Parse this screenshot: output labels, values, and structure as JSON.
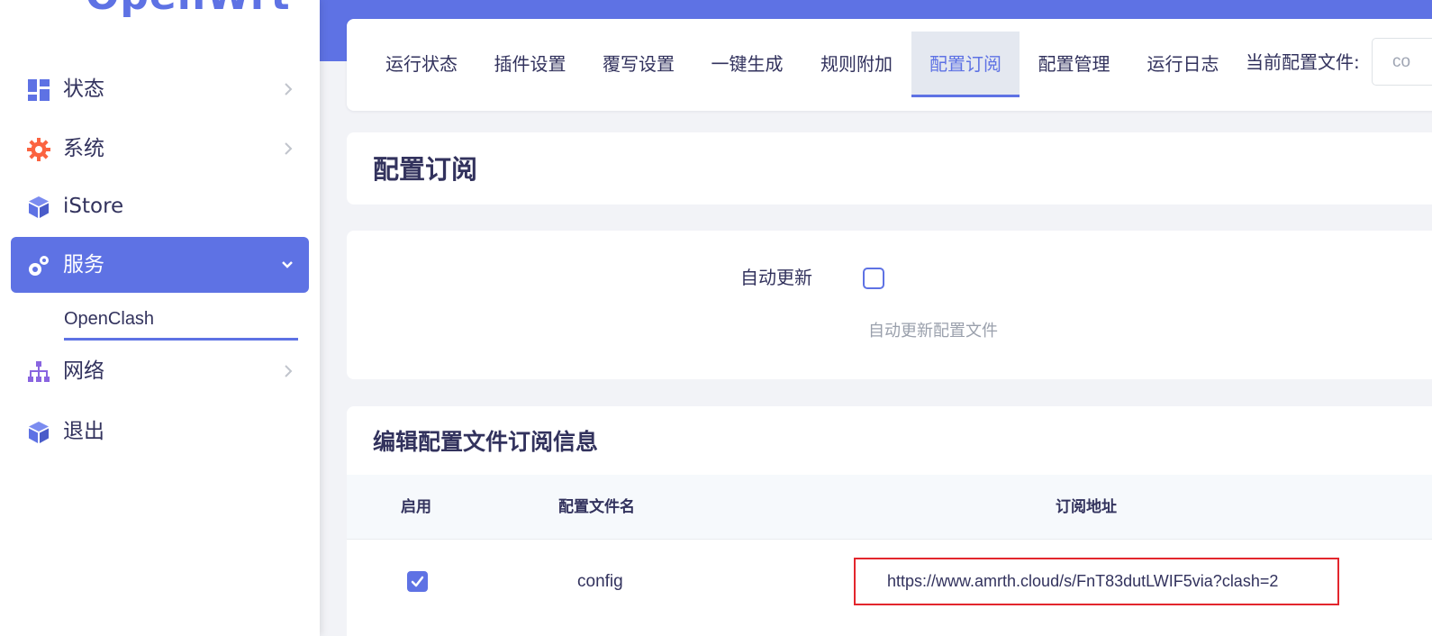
{
  "sidebar": {
    "brand": "OpenWrt",
    "items": [
      {
        "label": "状态"
      },
      {
        "label": "系统"
      },
      {
        "label": "iStore"
      },
      {
        "label": "服务"
      },
      {
        "label": "网络"
      },
      {
        "label": "退出"
      }
    ],
    "sub_item": "OpenClash"
  },
  "tabs": [
    {
      "label": "运行状态"
    },
    {
      "label": "插件设置"
    },
    {
      "label": "覆写设置"
    },
    {
      "label": "一键生成"
    },
    {
      "label": "规则附加"
    },
    {
      "label": "配置订阅"
    },
    {
      "label": "配置管理"
    },
    {
      "label": "运行日志"
    }
  ],
  "current_config": {
    "label": "当前配置文件:",
    "value": "co"
  },
  "page_title": "配置订阅",
  "auto_update": {
    "label": "自动更新",
    "checked": false,
    "description": "自动更新配置文件"
  },
  "subscription": {
    "title": "编辑配置文件订阅信息",
    "columns": [
      "启用",
      "配置文件名",
      "订阅地址"
    ],
    "rows": [
      {
        "enabled": true,
        "name": "config",
        "url": "https://www.amrth.cloud/s/FnT83dutLWIF5via?clash=2"
      }
    ]
  },
  "colors": {
    "accent": "#5e72e4",
    "highlight_border": "#e3262d",
    "status_icon": "#5e72e4",
    "system_icon": "#fb6340"
  }
}
